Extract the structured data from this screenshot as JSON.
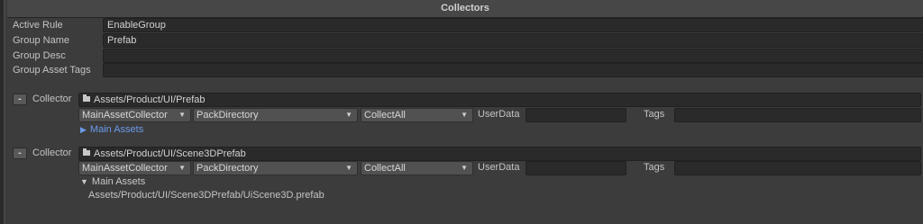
{
  "header": {
    "title": "Collectors"
  },
  "fields": {
    "active_rule": {
      "label": "Active Rule",
      "value": "EnableGroup"
    },
    "group_name": {
      "label": "Group Name",
      "value": "Prefab"
    },
    "group_desc": {
      "label": "Group Desc",
      "value": ""
    },
    "group_asset_tags": {
      "label": "Group Asset Tags",
      "value": ""
    }
  },
  "collectors": [
    {
      "remove_label": "-",
      "label": "Collector",
      "path": "Assets/Product/UI/Prefab",
      "collector_type": "MainAssetCollector",
      "address_rule": "PackDirectory",
      "filter_rule": "CollectAll",
      "user_data_label": "UserData",
      "user_data_value": "",
      "tags_label": "Tags",
      "tags_value": "",
      "foldout_label": "Main Assets",
      "foldout_expanded": false,
      "assets": []
    },
    {
      "remove_label": "-",
      "label": "Collector",
      "path": "Assets/Product/UI/Scene3DPrefab",
      "collector_type": "MainAssetCollector",
      "address_rule": "PackDirectory",
      "filter_rule": "CollectAll",
      "user_data_label": "UserData",
      "user_data_value": "",
      "tags_label": "Tags",
      "tags_value": "",
      "foldout_label": "Main Assets",
      "foldout_expanded": true,
      "assets": [
        "Assets/Product/UI/Scene3DPrefab/UiScene3D.prefab"
      ]
    }
  ],
  "icons": {
    "collapsed": "▶",
    "expanded": "▼",
    "dropdown": "▼"
  }
}
